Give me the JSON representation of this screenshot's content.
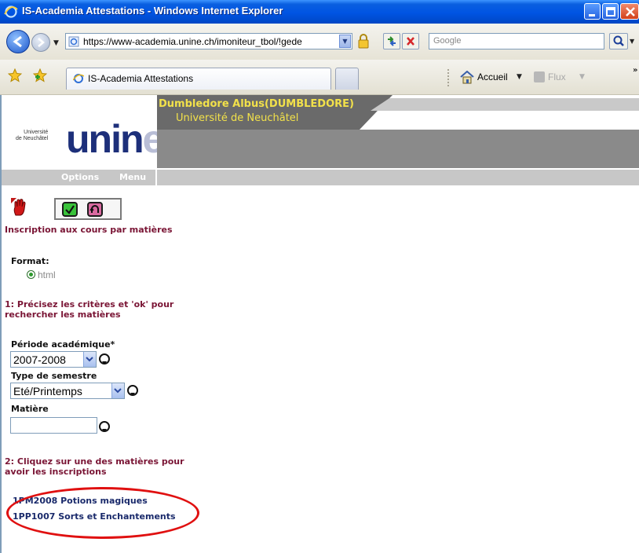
{
  "window": {
    "title": "IS-Academia Attestations - Windows Internet Explorer"
  },
  "toolbar": {
    "url": "https://www-academia.unine.ch/imoniteur_tbol/!gede",
    "search_placeholder": "Google"
  },
  "favorites_bar": {
    "tab_label": "IS-Academia Attestations",
    "home_label": "Accueil",
    "feeds_label": "Flux"
  },
  "banner": {
    "logo_small": "Université\nde Neuchâtel",
    "logo_main": "unine",
    "user": "Dumbledore Albus(DUMBLEDORE)",
    "university": "Université de Neuchâtel"
  },
  "menu": {
    "options": "Options",
    "menu": "Menu"
  },
  "form": {
    "title": "Inscription aux cours par matières",
    "format_label": "Format:",
    "format_option": "html",
    "step1": "1: Précisez les critères et 'ok' pour rechercher les matières",
    "periode_label": "Période académique*",
    "periode_value": "2007-2008",
    "semestre_label": "Type de semestre",
    "semestre_value": "Eté/Printemps",
    "matiere_label": "Matière",
    "matiere_value": "",
    "step2": "2: Cliquez sur une des matières pour avoir les inscriptions"
  },
  "courses": [
    {
      "label": "1PM2008 Potions magiques"
    },
    {
      "label": "1PP1007 Sorts et Enchantements"
    }
  ],
  "colors": {
    "titlebar": "#0054e3",
    "heading_red": "#7a1535",
    "link_blue": "#1a2a6b",
    "annotation_red": "#e01010",
    "banner_yellow": "#f2e14a"
  }
}
